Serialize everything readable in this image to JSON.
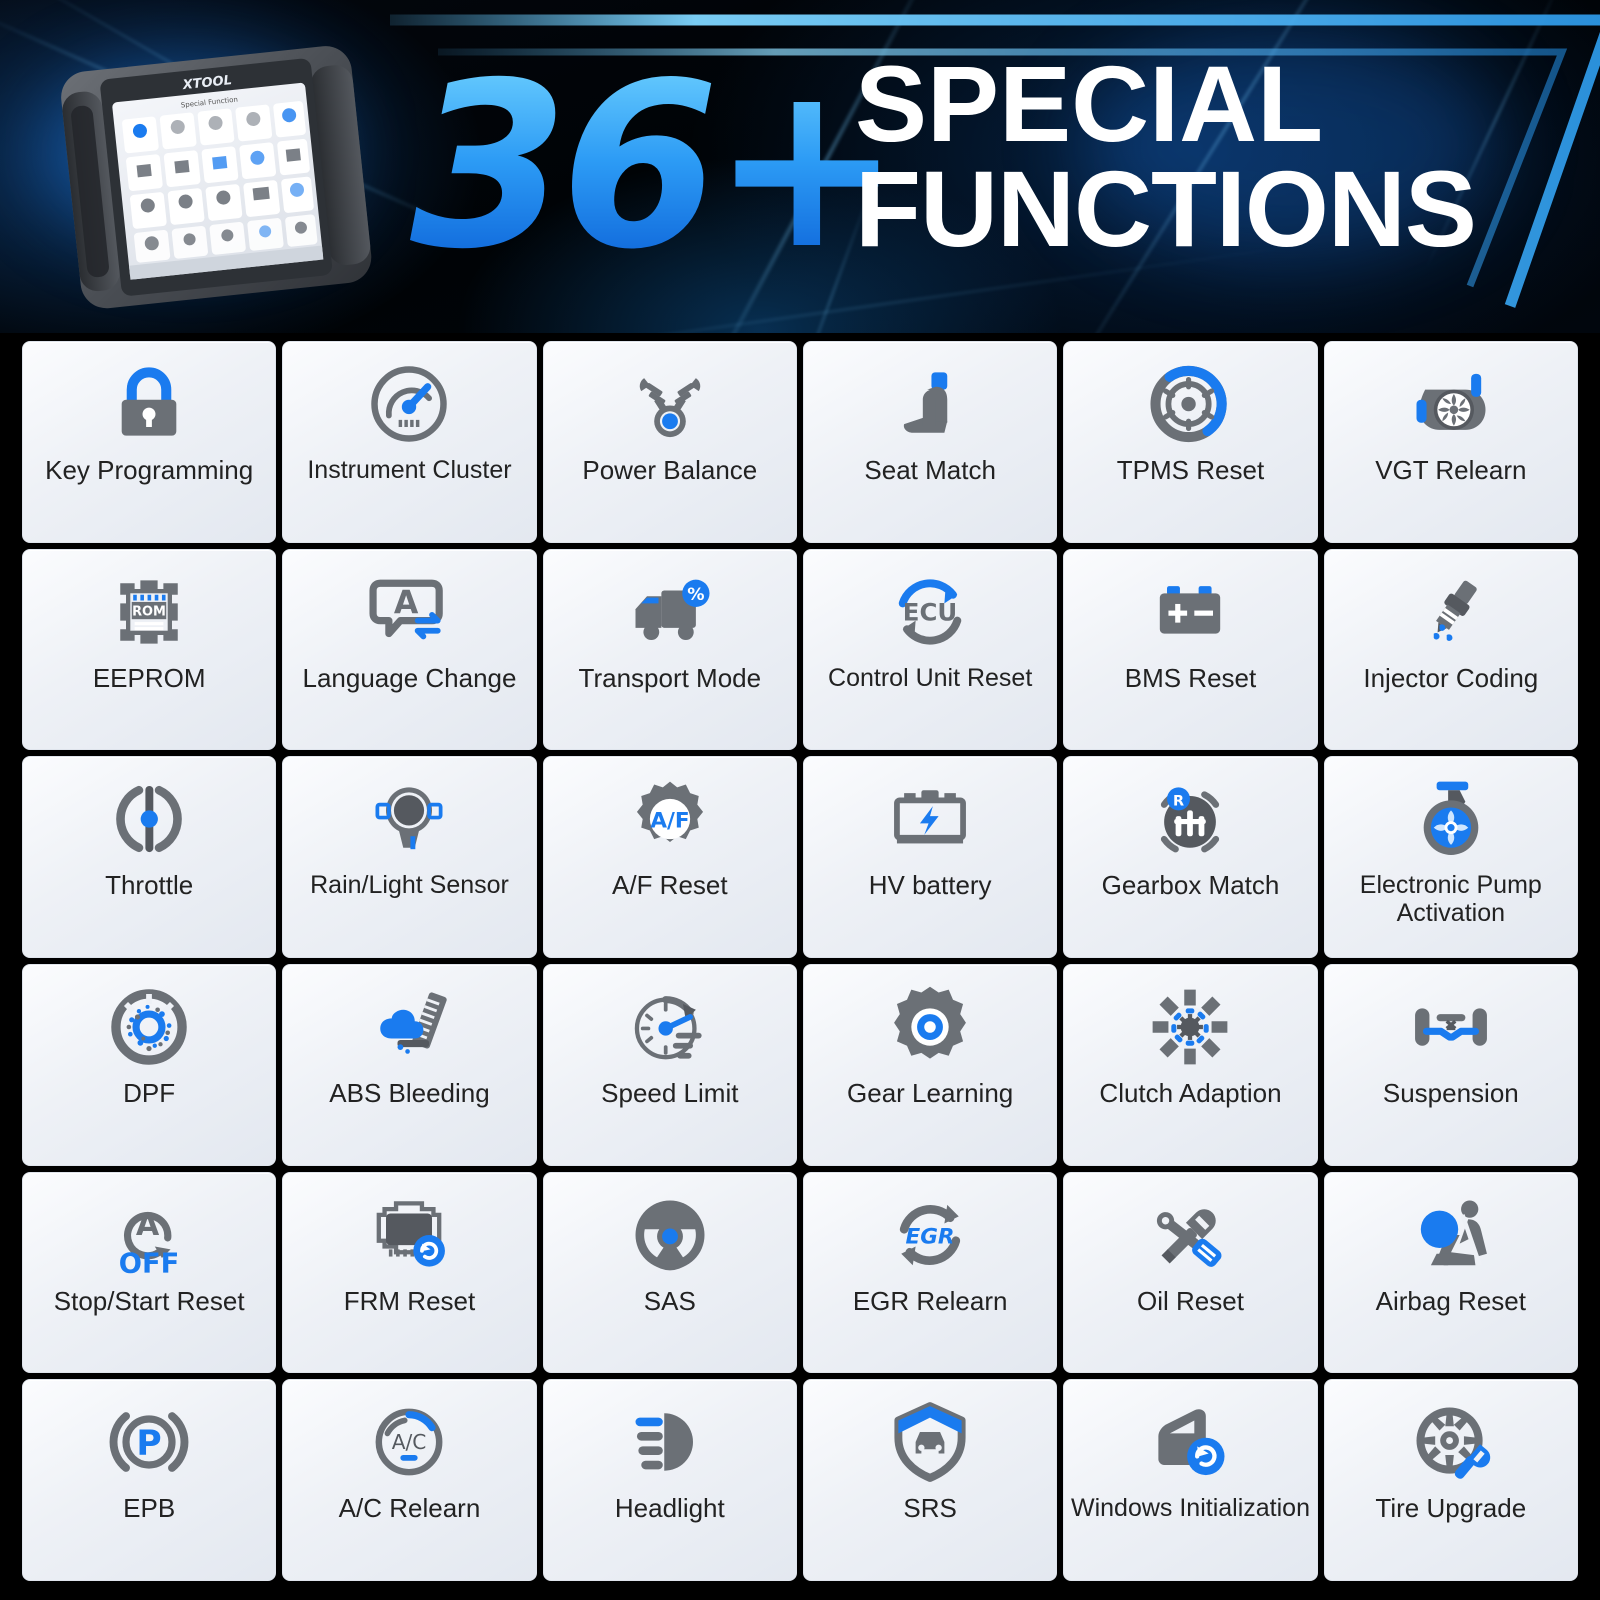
{
  "hero": {
    "count": "36+",
    "title_line1": "SPECIAL",
    "title_line2": "FUNCTIONS",
    "device_brand": "XTOOL",
    "device_screen_title": "Special Function",
    "accent_blue": "#1a7bef",
    "accent_cyan": "#6fd2ff",
    "background": "#000000"
  },
  "grid": {
    "columns": 6,
    "rows": 6,
    "tiles": [
      {
        "label": "Key Programming",
        "icon": "lock-icon"
      },
      {
        "label": "Instrument Cluster",
        "icon": "gauge-icon"
      },
      {
        "label": "Power Balance",
        "icon": "piston-v-icon"
      },
      {
        "label": "Seat Match",
        "icon": "car-seat-icon"
      },
      {
        "label": "TPMS Reset",
        "icon": "tire-pressure-icon"
      },
      {
        "label": "VGT Relearn",
        "icon": "turbo-icon"
      },
      {
        "label": "EEPROM",
        "icon": "rom-chip-icon"
      },
      {
        "label": "Language Change",
        "icon": "language-bubble-icon"
      },
      {
        "label": "Transport Mode",
        "icon": "truck-icon"
      },
      {
        "label": "Control Unit Reset",
        "icon": "ecu-refresh-icon"
      },
      {
        "label": "BMS Reset",
        "icon": "battery-terminals-icon"
      },
      {
        "label": "Injector Coding",
        "icon": "injector-icon"
      },
      {
        "label": "Throttle",
        "icon": "throttle-icon"
      },
      {
        "label": "Rain/Light Sensor",
        "icon": "rain-light-sensor-icon"
      },
      {
        "label": "A/F Reset",
        "icon": "af-gear-icon"
      },
      {
        "label": "HV battery",
        "icon": "hv-battery-icon"
      },
      {
        "label": "Gearbox Match",
        "icon": "gearbox-icon"
      },
      {
        "label": "Electronic Pump Activation",
        "icon": "electronic-pump-icon"
      },
      {
        "label": "DPF",
        "icon": "dpf-filter-icon"
      },
      {
        "label": "ABS Bleeding",
        "icon": "abs-bleeding-icon"
      },
      {
        "label": "Speed Limit",
        "icon": "speed-limit-icon"
      },
      {
        "label": "Gear Learning",
        "icon": "gear-learning-icon"
      },
      {
        "label": "Clutch  Adaption",
        "icon": "clutch-icon"
      },
      {
        "label": "Suspension",
        "icon": "suspension-icon"
      },
      {
        "label": "Stop/Start Reset",
        "icon": "auto-stop-start-off-icon"
      },
      {
        "label": "FRM Reset",
        "icon": "frm-chip-refresh-icon"
      },
      {
        "label": "SAS",
        "icon": "steering-wheel-icon"
      },
      {
        "label": "EGR Relearn",
        "icon": "egr-refresh-icon"
      },
      {
        "label": "Oil Reset",
        "icon": "wrench-screwdriver-icon"
      },
      {
        "label": "Airbag Reset",
        "icon": "airbag-seat-icon"
      },
      {
        "label": "EPB",
        "icon": "parking-brake-icon"
      },
      {
        "label": "A/C Relearn",
        "icon": "ac-gauge-icon"
      },
      {
        "label": "Headlight",
        "icon": "headlight-icon"
      },
      {
        "label": "SRS",
        "icon": "shield-car-icon"
      },
      {
        "label": "Windows Initialization",
        "icon": "car-door-refresh-icon"
      },
      {
        "label": "Tire Upgrade",
        "icon": "tire-wrench-icon"
      }
    ]
  }
}
